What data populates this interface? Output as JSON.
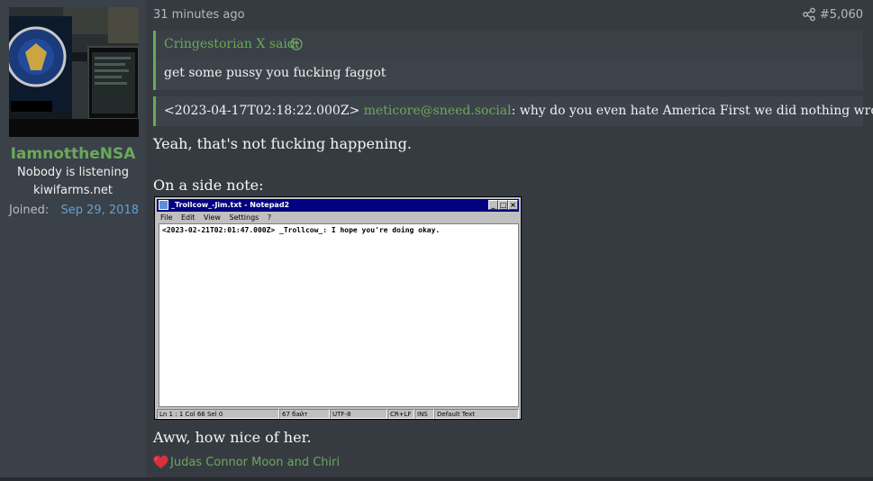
{
  "user": {
    "username": "IamnottheNSA",
    "title_line1": "Nobody is listening",
    "title_line2": "kiwifarms.net",
    "joined_label": "Joined:",
    "joined_value": "Sep 29, 2018"
  },
  "post": {
    "timestamp": "31 minutes ago",
    "post_number": "#5,060",
    "share_icon": "share-icon"
  },
  "quote": {
    "author": "Cringestorian X said:",
    "arrow_icon": "arrow-up-circle-icon",
    "body": "get some pussy you fucking faggot"
  },
  "quote2": {
    "prefix": "<2023-04-17T02:18:22.000Z>",
    "handle": "meticore@sneed.social",
    "text": ": why do you even hate America First we did nothing wrong"
  },
  "body": {
    "line1": "Yeah, that's not fucking happening.",
    "line2": "On a side note:",
    "line3": "Aww, how nice of her."
  },
  "notepad": {
    "title": "_Trollcow_-Jim.txt - Notepad2",
    "menu": [
      "File",
      "Edit",
      "View",
      "Settings",
      "?"
    ],
    "content": "<2023-02-21T02:01:47.000Z> _Trollcow_: I hope you're doing okay.",
    "status": [
      "Ln 1 : 1   Col 66   Sel 0",
      "67 байт",
      "UTF-8",
      "CR+LF",
      "INS",
      "Default Text"
    ],
    "btn_min": "_",
    "btn_max": "□",
    "btn_close": "×"
  },
  "reaction": {
    "icon": "heart-icon",
    "text": "Judas Connor Moon and Chiri"
  },
  "colors": {
    "accent_green": "#6aa95a",
    "link_blue": "#5fa1d5",
    "post_bg": "#363b42"
  }
}
